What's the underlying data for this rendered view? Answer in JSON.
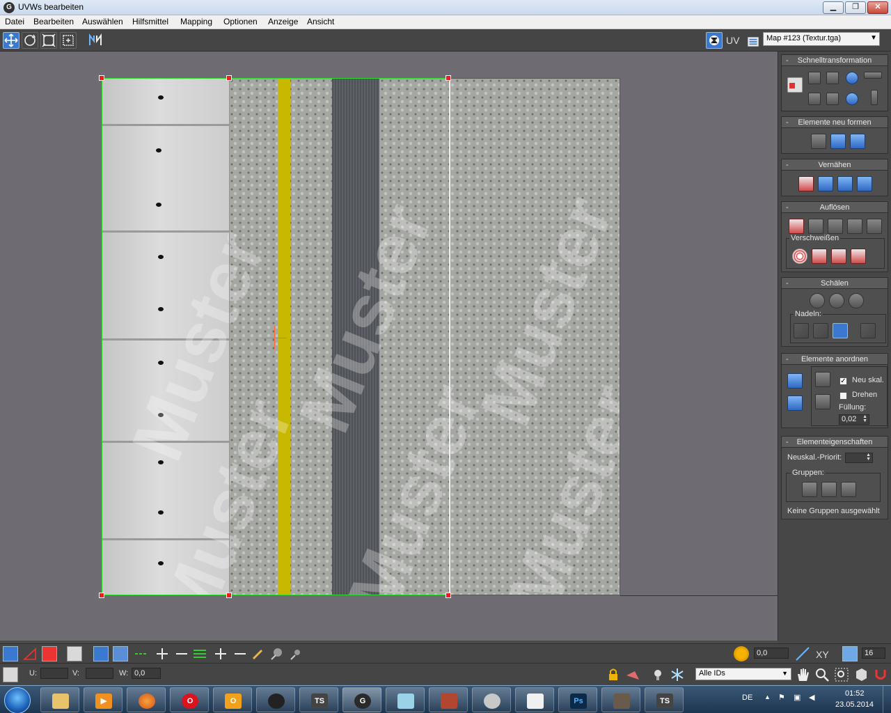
{
  "window": {
    "title": "UVWs bearbeiten",
    "app_icon": "3ds-max-icon",
    "buttons": {
      "minimize": "▁",
      "maximize": "❐",
      "close": "✕"
    }
  },
  "menu": {
    "items": [
      "Datei",
      "Bearbeiten",
      "Auswählen",
      "Hilfsmittel",
      "Mapping",
      "Optionen",
      "Anzeige",
      "Ansicht"
    ]
  },
  "toolbar": {
    "tools": [
      "move-icon",
      "rotate-icon",
      "scale-icon",
      "freeform-icon",
      "mirror-icon"
    ],
    "uv_label": "UV",
    "map_select": "Map #123 (Textur.tga)"
  },
  "viewport": {
    "texture_watermark": "Muster"
  },
  "panel": {
    "schnelltransformation": {
      "title": "Schnelltransformation"
    },
    "elemente_neu_formen": {
      "title": "Elemente neu formen"
    },
    "vernaehen": {
      "title": "Vernähen"
    },
    "aufloesen": {
      "title": "Auflösen",
      "sub": "Verschweißen"
    },
    "schaelen": {
      "title": "Schälen",
      "sub": "Nadeln:"
    },
    "elemente_anordnen": {
      "title": "Elemente anordnen",
      "neu_skal": "Neu skal.",
      "neu_skal_checked": true,
      "drehen": "Drehen",
      "drehen_checked": false,
      "fuellung_label": "Füllung:",
      "fuellung_value": "0,02"
    },
    "elementeigenschaften": {
      "title": "Elementeigenschaften",
      "neuskal_label": "Neuskal.-Priorit:",
      "gruppen_label": "Gruppen:",
      "status": "Keine Gruppen ausgewählt"
    }
  },
  "bottom": {
    "angle_value": "0,0",
    "xy_label": "XY",
    "grid_value": "16",
    "u_label": "U:",
    "v_label": "V:",
    "w_label": "W:",
    "w_value": "0,0",
    "id_select": "Alle IDs"
  },
  "taskbar": {
    "apps": [
      "explorer",
      "media-player",
      "firefox",
      "opera",
      "outlook",
      "steam",
      "train-simulator",
      "3ds-max",
      "notepad",
      "train-game",
      "settings",
      "layout-app",
      "photoshop",
      "locomotive-game",
      "train-simulator-2"
    ],
    "app_glyphs": {
      "photoshop": "Ps",
      "train-simulator": "TS",
      "train-simulator-2": "TS"
    },
    "language": "DE",
    "time": "01:52",
    "date": "23.05.2014"
  },
  "colors": {
    "accent": "#3b78d0",
    "uv_selection": "#2fdc2f",
    "vertex": "#e82020",
    "road_yellow": "#c9b800"
  }
}
